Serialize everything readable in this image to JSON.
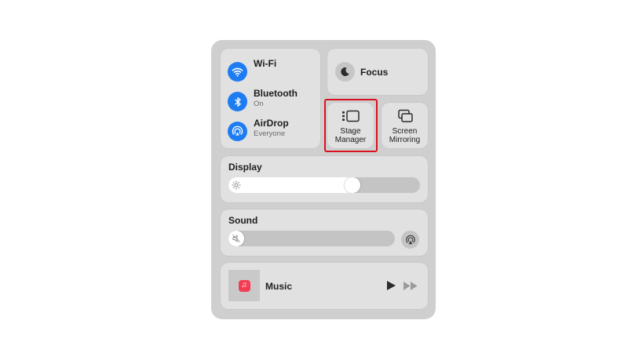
{
  "connectivity": {
    "wifi": {
      "label": "Wi-Fi",
      "icon": "wifi-icon"
    },
    "bluetooth": {
      "label": "Bluetooth",
      "status": "On",
      "icon": "bluetooth-icon"
    },
    "airdrop": {
      "label": "AirDrop",
      "status": "Everyone",
      "icon": "airdrop-icon"
    }
  },
  "focus": {
    "label": "Focus",
    "icon": "moon-icon"
  },
  "stage_manager": {
    "label_line1": "Stage",
    "label_line2": "Manager",
    "icon": "stage-manager-icon"
  },
  "screen_mirroring": {
    "label_line1": "Screen",
    "label_line2": "Mirroring",
    "icon": "screen-mirroring-icon"
  },
  "display": {
    "label": "Display",
    "brightness": 0.66,
    "icon": "sun-icon"
  },
  "sound": {
    "label": "Sound",
    "volume": 0.0,
    "icon": "speaker-muted-icon",
    "output_icon": "airplay-audio-icon"
  },
  "now_playing": {
    "app": "Music",
    "icon": "music-app-icon",
    "controls": [
      "play-icon",
      "fast-forward-icon"
    ]
  },
  "colors": {
    "accent": "#1e7cf2",
    "highlight": "#d9111f",
    "tile": "#e1e1e1",
    "panel": "#cfcfcf",
    "music": "#f43d55"
  }
}
